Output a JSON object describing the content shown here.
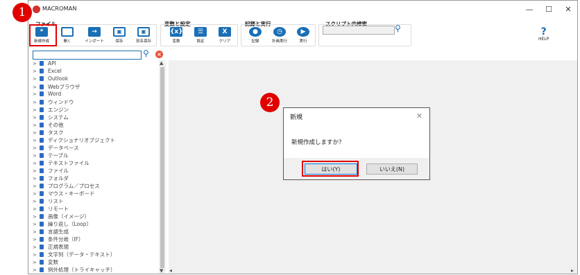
{
  "window": {
    "title": "MACROMAN",
    "controls": [
      "—",
      "☐",
      "✕"
    ]
  },
  "ribbon": {
    "groups": [
      {
        "label": "ファイル",
        "buttons": [
          {
            "label": "新規作成",
            "icon": "star-new-icon",
            "glyph": "*"
          },
          {
            "label": "開く",
            "icon": "folder-icon",
            "glyph": ""
          },
          {
            "label": "インポート",
            "icon": "import-arrow-icon",
            "glyph": "→"
          },
          {
            "label": "保存",
            "icon": "save-icon",
            "glyph": "▣"
          },
          {
            "label": "別名保存",
            "icon": "save-as-icon",
            "glyph": "▣"
          }
        ]
      },
      {
        "label": "変数と設定",
        "buttons": [
          {
            "label": "変数",
            "icon": "variable-icon",
            "glyph": "{x}"
          },
          {
            "label": "設定",
            "icon": "settings-list-icon",
            "glyph": "☰"
          },
          {
            "label": "クリア",
            "icon": "clear-icon",
            "glyph": "X"
          }
        ]
      },
      {
        "label": "記録と実行",
        "buttons": [
          {
            "label": "記録",
            "icon": "record-icon",
            "glyph": "●"
          },
          {
            "label": "計画実行",
            "icon": "schedule-clock-icon",
            "glyph": "◷"
          },
          {
            "label": "実行",
            "icon": "play-icon",
            "glyph": "▶"
          }
        ]
      },
      {
        "label": "スクリプト内検索",
        "buttons": []
      }
    ],
    "help_label": "HELP",
    "help_glyph": "?"
  },
  "tree": {
    "items": [
      "API",
      "Excel",
      "Outlook",
      "Webブラウザ",
      "Word",
      "ウィンドウ",
      "エンジン",
      "システム",
      "その他",
      "タスク",
      "ディクショナリオブジェクト",
      "データベース",
      "テーブル",
      "テキストファイル",
      "ファイル",
      "フォルダ",
      "プログラム／プロセス",
      "マウス・キーボード",
      "リスト",
      "リモート",
      "画像（イメージ）",
      "繰り返し（Loop）",
      "言語生成",
      "条件分岐（IF）",
      "正規表現",
      "文字列（データ・テキスト）",
      "変数",
      "例外処理（トライキャッチ）"
    ]
  },
  "dialog": {
    "title": "新規",
    "message": "新規作成しますか？",
    "yes_label": "はい(Y)",
    "no_label": "いいえ(N)",
    "close_glyph": "✕"
  },
  "callouts": [
    "1",
    "2"
  ],
  "colors": {
    "accent": "#1a6fb5",
    "highlight": "#e00000",
    "clear": "#e8523a"
  }
}
